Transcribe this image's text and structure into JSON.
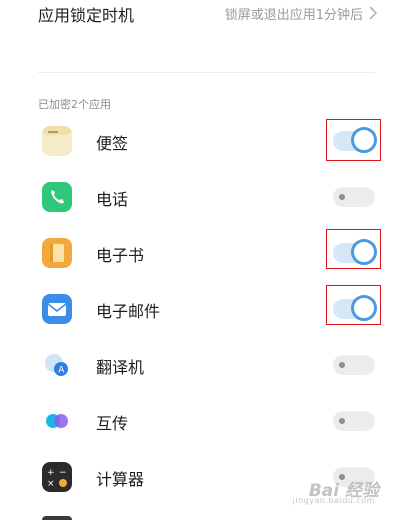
{
  "header": {
    "title": "应用锁定时机",
    "value": "锁屏或退出应用1分钟后",
    "chevron_icon": "chevron-right-icon"
  },
  "section": {
    "label": "已加密2个应用"
  },
  "apps": [
    {
      "name": "便签",
      "icon": "notes-icon",
      "enabled": true,
      "highlighted": true
    },
    {
      "name": "电话",
      "icon": "phone-icon",
      "enabled": false,
      "highlighted": false
    },
    {
      "name": "电子书",
      "icon": "ebook-icon",
      "enabled": true,
      "highlighted": true
    },
    {
      "name": "电子邮件",
      "icon": "email-icon",
      "enabled": true,
      "highlighted": true
    },
    {
      "name": "翻译机",
      "icon": "translator-icon",
      "enabled": false,
      "highlighted": false
    },
    {
      "name": "互传",
      "icon": "share-transfer-icon",
      "enabled": false,
      "highlighted": false
    },
    {
      "name": "计算器",
      "icon": "calculator-icon",
      "enabled": false,
      "highlighted": false
    }
  ],
  "watermark": {
    "text": "Bai 经验",
    "subtext": "jingyan.baidu.com"
  },
  "colors": {
    "toggle_on_track": "#d6e8f7",
    "toggle_on_ring": "#4b9be0",
    "toggle_off_track": "#ececec",
    "highlight_box": "#d8161b"
  }
}
